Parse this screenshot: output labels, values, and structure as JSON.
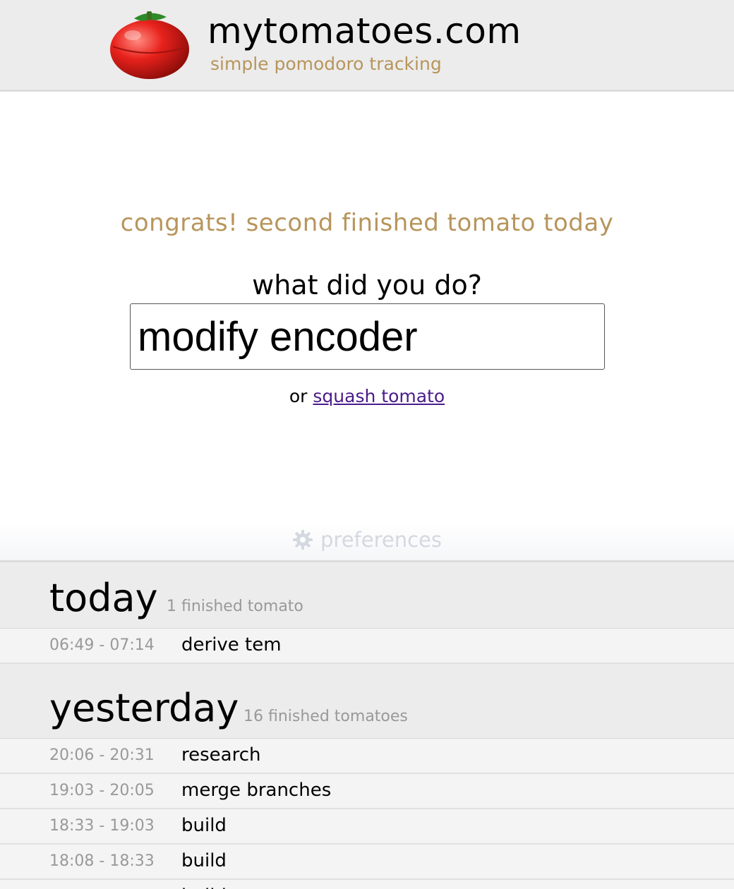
{
  "header": {
    "title": "mytomatoes.com",
    "subtitle": "simple pomodoro tracking",
    "logo_icon": "tomato-timer-icon"
  },
  "main": {
    "congrats": "congrats! second finished tomato today",
    "question": "what did you do?",
    "input_value": "modify encoder",
    "or_text": "or",
    "squash_link": "squash tomato"
  },
  "preferences": {
    "label": "preferences",
    "icon": "gear-icon"
  },
  "history": {
    "today": {
      "title": "today",
      "count": "1 finished tomato",
      "rows": [
        {
          "time": "06:49 - 07:14",
          "desc": "derive tem"
        }
      ]
    },
    "yesterday": {
      "title": "yesterday",
      "count": "16 finished tomatoes",
      "rows": [
        {
          "time": "20:06 - 20:31",
          "desc": "research"
        },
        {
          "time": "19:03 - 20:05",
          "desc": "merge branches"
        },
        {
          "time": "18:33 - 19:03",
          "desc": "build"
        },
        {
          "time": "18:08 - 18:33",
          "desc": "build"
        },
        {
          "time": "",
          "desc": "build"
        }
      ]
    }
  },
  "colors": {
    "accent": "#b7955c",
    "link": "#4b1c8a",
    "header_bg": "#ececec"
  }
}
